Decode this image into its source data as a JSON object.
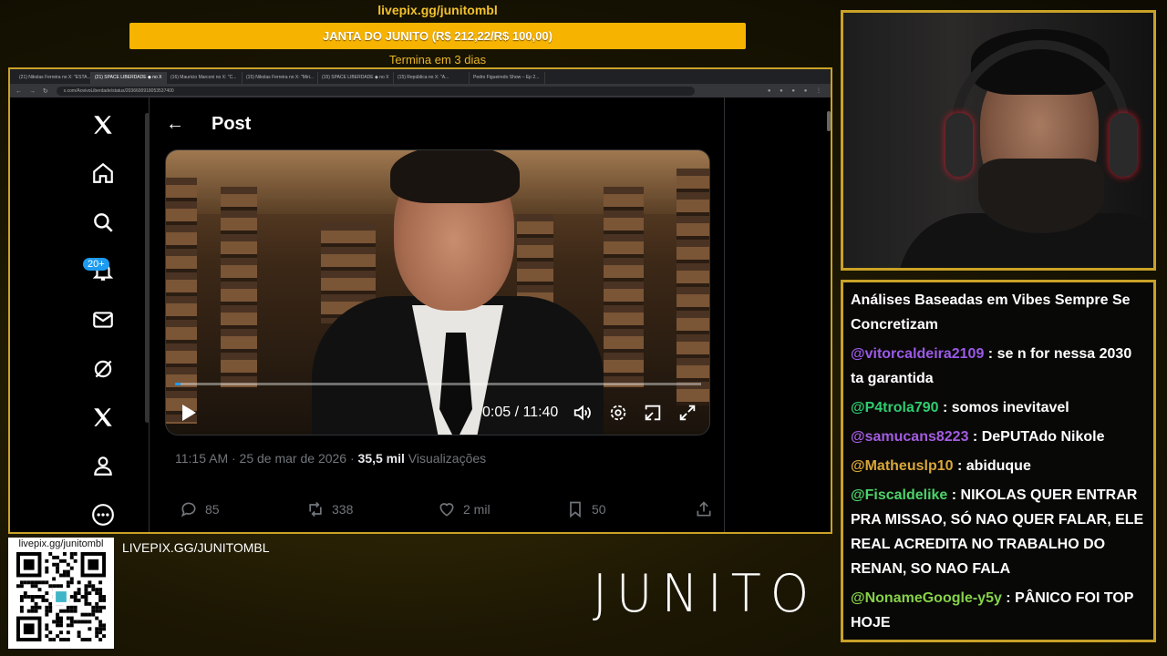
{
  "goal": {
    "url": "livepix.gg/junitombl",
    "title": "JANTA DO JUNITO (R$ 212,22/R$ 100,00)",
    "progress_fraction": 1.0,
    "ends": "Termina em 3 dias",
    "color": "#f6b300"
  },
  "browser": {
    "tabs": [
      "(21) Nikolas Ferreira no X: \"ESTA...",
      "(21) SPACE LIBERDADE ◆ no X",
      "(16) Mauricio Marconi no X: \"C...",
      "(15) Nikolas Ferreira no X: \"Miri...",
      "(15) SPACE LIBERDADE ◆ no X",
      "(15) República no X: \"A...",
      "Pedro Figueiredo Show – Ep 2..."
    ],
    "active_tab_index": 1,
    "url": "x.com/AovivoLiberdade/status/2036600918053537400",
    "sidebar": {
      "icons": [
        "x-logo-icon",
        "home-icon",
        "search-icon",
        "notifications-icon",
        "messages-icon",
        "grok-icon",
        "premium-x-icon",
        "profile-icon",
        "more-icon"
      ],
      "notification_badge": "20+"
    },
    "post": {
      "header_title": "Post",
      "video": {
        "current_time": "0:05",
        "duration": "11:40",
        "time_display": "0:05 / 11:40",
        "progress_fraction": 0.007
      },
      "timestamp": "11:15 AM · 25 de mar de 2026 · ",
      "views_count": "35,5 mil",
      "views_label": " Visualizações",
      "actions": {
        "replies": "85",
        "reposts": "338",
        "likes": "2 mil",
        "bookmarks": "50"
      }
    },
    "accent_color": "#1d9bf0"
  },
  "overlay": {
    "qr_label": "livepix.gg/junitombl",
    "pix_url": "LIVEPIX.GG/JUNITOMBL",
    "brand": "JUNITO",
    "frame_color": "#c9a227"
  },
  "chat": {
    "messages": [
      {
        "user": "",
        "text": "Análises Baseadas em Vibes Sempre Se Concretizam",
        "color": "#ffffff"
      },
      {
        "user": "@vitorcaldeira2109",
        "text": " : se n for nessa 2030 ta garantida",
        "color": "#9b59e8"
      },
      {
        "user": "@P4trola790",
        "text": " : somos inevitavel",
        "color": "#2ecc71"
      },
      {
        "user": "@samucans8223",
        "text": " : DePUTAdo Nikole",
        "color": "#a35ce0"
      },
      {
        "user": "@Matheuslp10",
        "text": " : abiduque",
        "color": "#d8a63a"
      },
      {
        "user": "@Fiscaldelike",
        "text": " : NIKOLAS QUER ENTRAR PRA MISSAO, SÓ NAO QUER FALAR, ELE REAL ACREDITA NO TRABALHO DO RENAN, SO NAO FALA",
        "color": "#4cd36a"
      },
      {
        "user": "@NonameGoogle-y5y",
        "text": " : PÂNICO FOI TOP HOJE",
        "color": "#86d14a"
      }
    ]
  }
}
